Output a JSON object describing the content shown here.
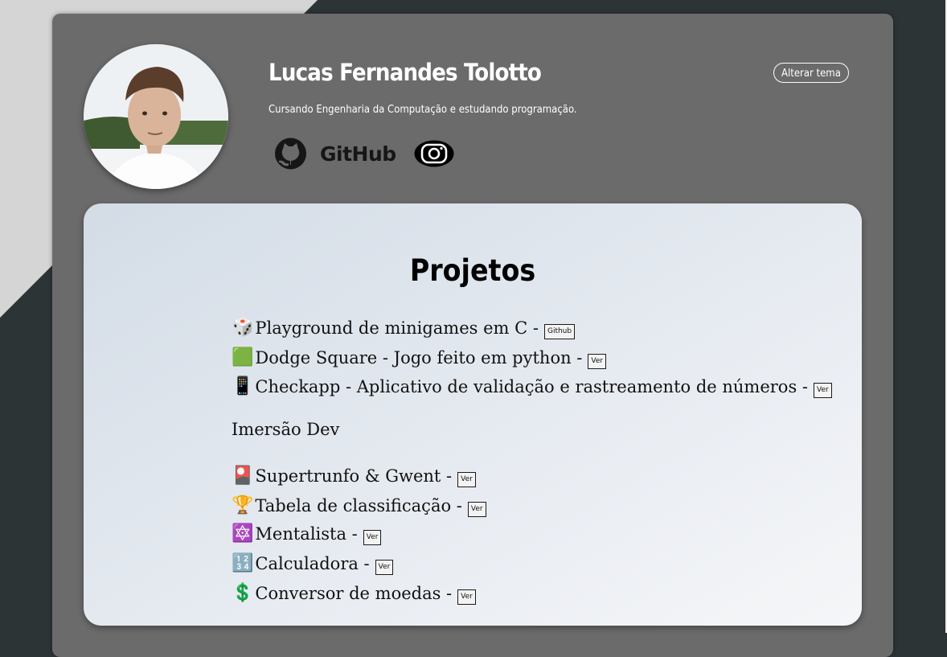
{
  "profile": {
    "name": "Lucas Fernandes Tolotto",
    "bio": "Cursando Engenharia da Computação e estudando programação.",
    "github_label": "GitHub",
    "theme_button": "Alterar tema"
  },
  "projects": {
    "title": "Projetos",
    "items": [
      {
        "icon": "🎲",
        "icon_name": "dice-icon",
        "label": "Playground de minigames em C -",
        "button": "Github"
      },
      {
        "icon": "🟩",
        "icon_name": "green-square-icon",
        "label": "Dodge Square - Jogo feito em python -",
        "button": "Ver"
      },
      {
        "icon": "📱",
        "icon_name": "phone-icon",
        "label": "Checkapp - Aplicativo de validação e rastreamento de números -",
        "button": "Ver"
      }
    ],
    "section_heading": "Imersão Dev",
    "section_items": [
      {
        "icon": "🎴",
        "icon_name": "card-icon",
        "label": "Supertrunfo & Gwent -",
        "button": "Ver"
      },
      {
        "icon": "🏆",
        "icon_name": "trophy-icon",
        "label": "Tabela de classificação -",
        "button": "Ver"
      },
      {
        "icon": "🔯",
        "icon_name": "star-icon",
        "label": "Mentalista -",
        "button": "Ver"
      },
      {
        "icon": "🔢",
        "icon_name": "numbers-icon",
        "label": "Calculadora -",
        "button": "Ver"
      },
      {
        "icon": "💲",
        "icon_name": "dollar-icon",
        "label": "Conversor de moedas -",
        "button": "Ver"
      }
    ]
  },
  "colors": {
    "background": "#2d3436",
    "card": "#6b6b6b",
    "accent_light": "#d5d5d5"
  }
}
